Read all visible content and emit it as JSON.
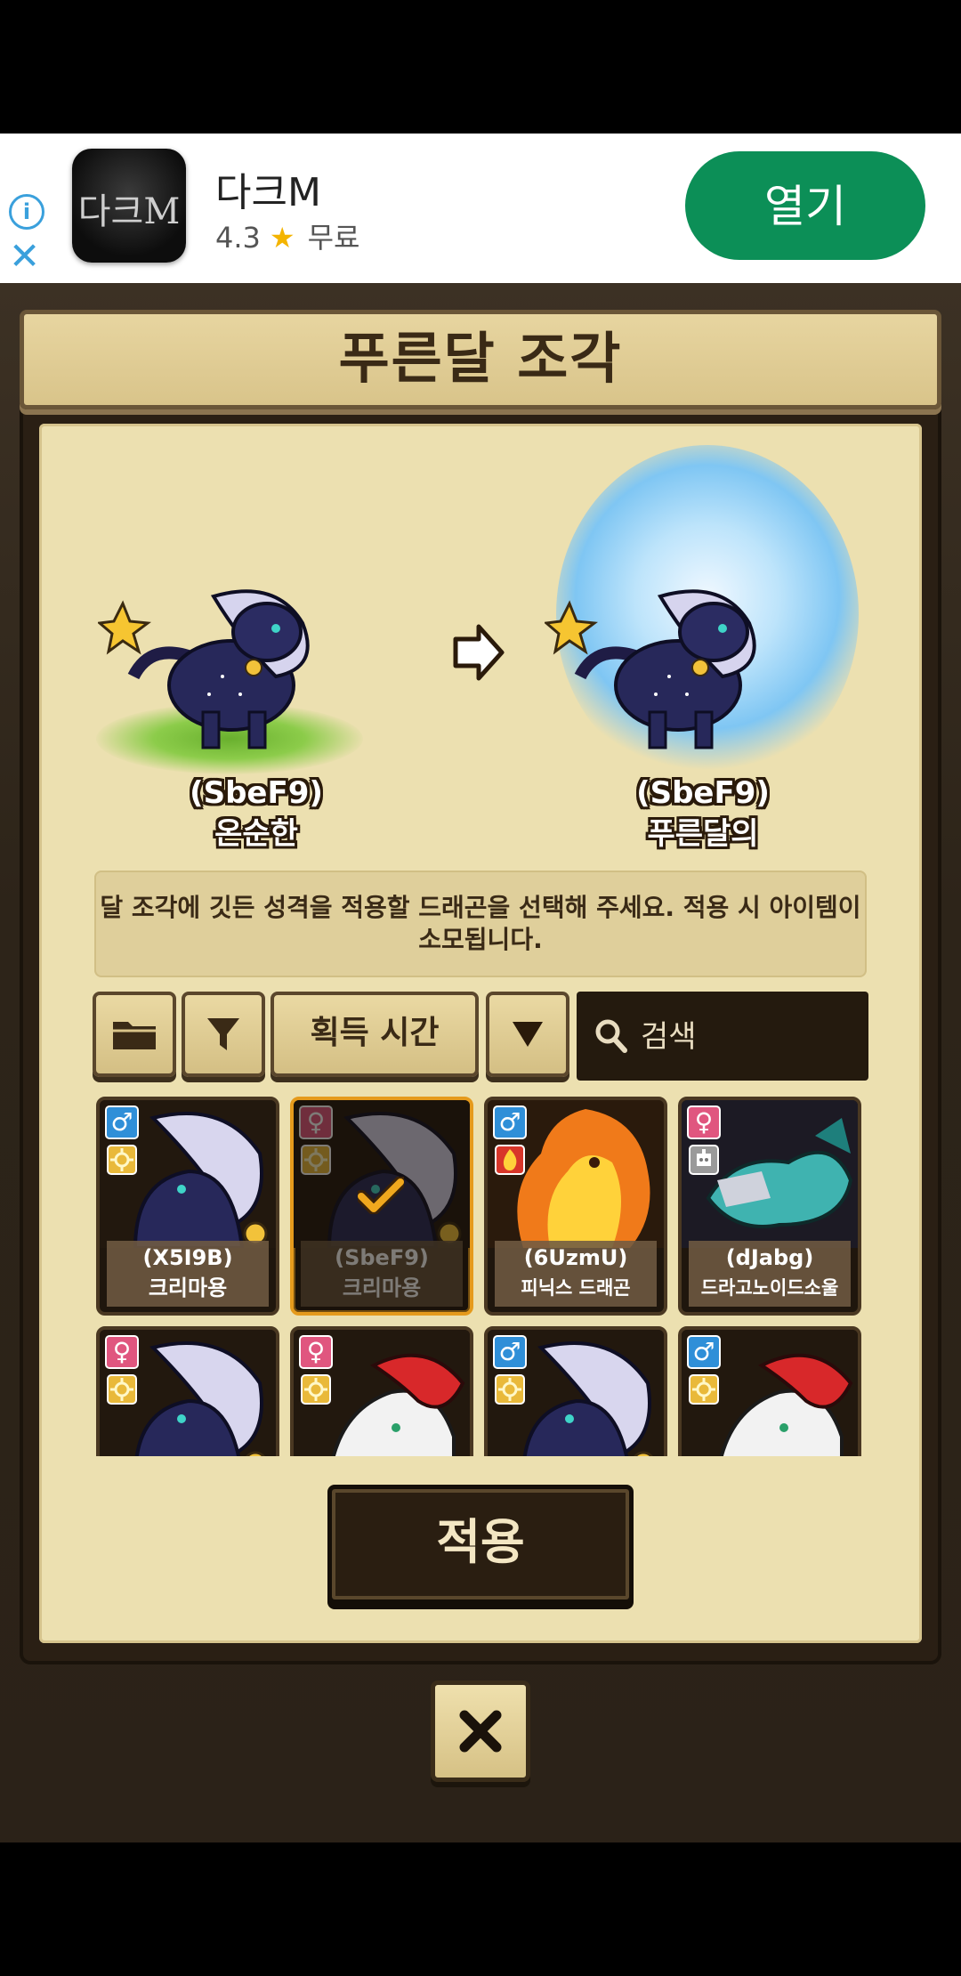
{
  "ad": {
    "app_name": "다크M",
    "rating": "4.3",
    "price": "무료",
    "open_label": "열기",
    "logo_text": "다크M",
    "info_icon": "info-icon",
    "close_icon": "close-x-icon"
  },
  "dialog": {
    "title": "푸른달 조각",
    "before": {
      "code": "(SbeF9)",
      "trait": "온순한"
    },
    "after": {
      "code": "(SbeF9)",
      "trait": "푸른달의"
    },
    "notice": "달 조각에 깃든 성격을 적용할 드래곤을 선택해 주세요. 적용 시 아이템이 소모됩니다.",
    "apply_label": "적용"
  },
  "toolbar": {
    "folder_icon": "folder-icon",
    "filter_icon": "filter-icon",
    "sort_label": "획득 시간",
    "sort_dir_icon": "triangle-down-icon",
    "search_placeholder": "검색"
  },
  "dragons": [
    {
      "code": "(X5I9B)",
      "name": "크리마용",
      "gender": "male",
      "element": "light",
      "selected": false
    },
    {
      "code": "(SbeF9)",
      "name": "크리마용",
      "gender": "female",
      "element": "light",
      "selected": true
    },
    {
      "code": "(6UzmU)",
      "name": "피닉스 드래곤",
      "gender": "male",
      "element": "fire",
      "selected": false
    },
    {
      "code": "(dJabg)",
      "name": "드라고노이드소울",
      "gender": "female",
      "element": "machine",
      "selected": false
    },
    {
      "code": "",
      "name": "",
      "gender": "female",
      "element": "light",
      "selected": false
    },
    {
      "code": "",
      "name": "",
      "gender": "female",
      "element": "light",
      "selected": false
    },
    {
      "code": "",
      "name": "",
      "gender": "male",
      "element": "light",
      "selected": false
    },
    {
      "code": "",
      "name": "",
      "gender": "male",
      "element": "light",
      "selected": false
    }
  ],
  "colors": {
    "male": "#2f8fd8",
    "female": "#e0567f",
    "light": "#e9b93a",
    "fire": "#d8362a",
    "machine": "#9a9a9a",
    "ad_button": "#0c8f57",
    "selected_border": "#e59a1c"
  }
}
